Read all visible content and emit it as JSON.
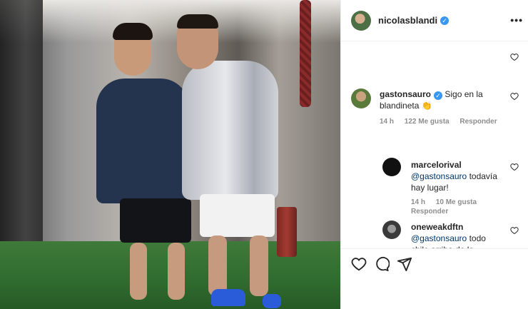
{
  "post": {
    "author": "nicolasblandi",
    "author_verified": true,
    "more_icon": "ellipsis-icon"
  },
  "comments": [
    {
      "username": "gastonsauro",
      "verified": true,
      "text": "Sigo en la blandineta",
      "emoji": "👏",
      "time": "14 h",
      "likes": "122 Me gusta",
      "reply": "Responder"
    },
    {
      "username": "marcelorival",
      "mention": "@gastonsauro",
      "text": " todavía hay lugar!",
      "time": "14 h",
      "likes": "10 Me gusta",
      "reply": "Responder"
    },
    {
      "username": "oneweakdftn",
      "mention": "@gastonsauro",
      "text": " todo chile arriba de la blandineta"
    }
  ],
  "actions": {
    "like_icon": "heart-icon",
    "comment_icon": "comment-icon",
    "share_icon": "share-icon"
  },
  "colors": {
    "verified": "#3897f0",
    "mention": "#00376b",
    "meta": "#8e8e8e"
  }
}
